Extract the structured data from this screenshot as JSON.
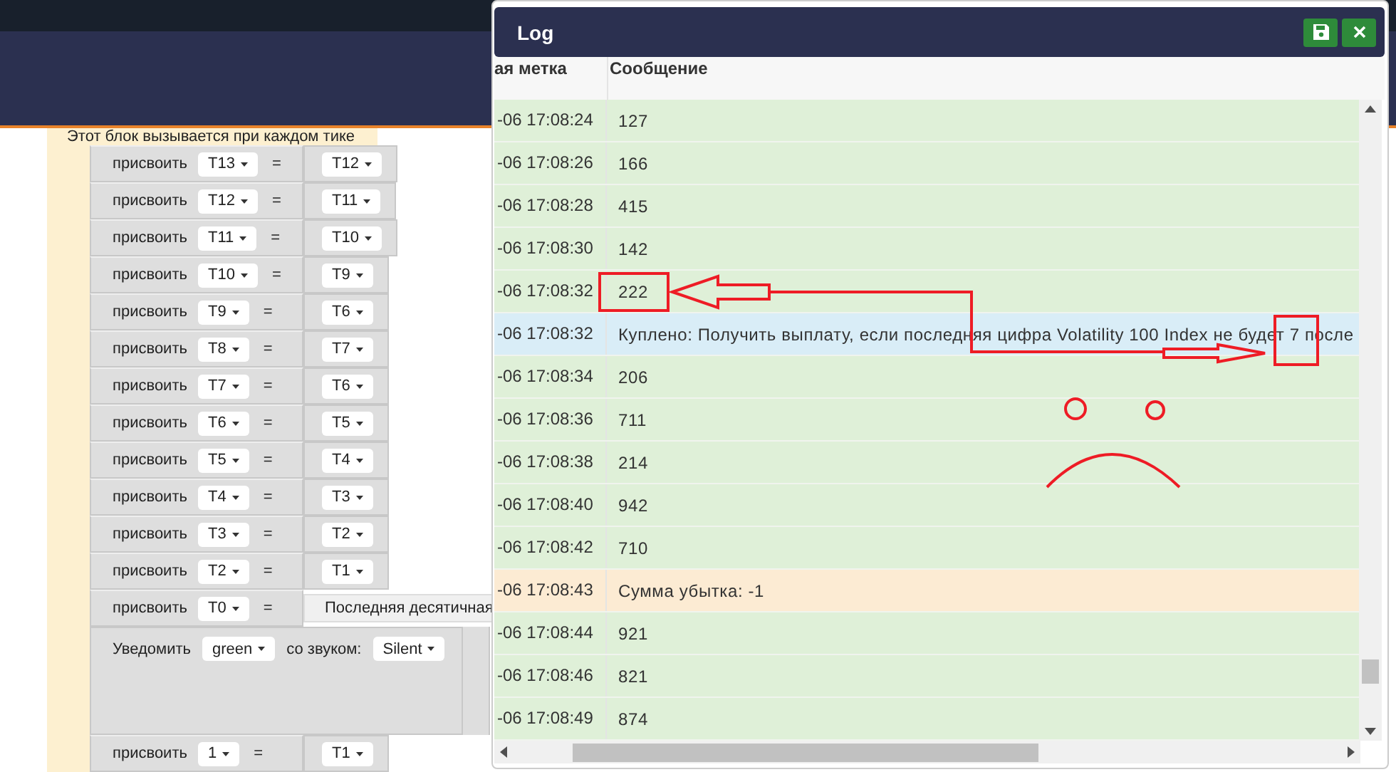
{
  "workspace": {
    "event_label": "Этот блок вызывается при каждом тике",
    "blocks": [
      {
        "kind": "assign",
        "label": "присвоить",
        "target": "T13",
        "op": "=",
        "value": {
          "kind": "dropdown",
          "text": "T12"
        }
      },
      {
        "kind": "assign",
        "label": "присвоить",
        "target": "T12",
        "op": "=",
        "value": {
          "kind": "dropdown",
          "text": "T11"
        }
      },
      {
        "kind": "assign",
        "label": "присвоить",
        "target": "T11",
        "op": "=",
        "value": {
          "kind": "dropdown",
          "text": "T10"
        }
      },
      {
        "kind": "assign",
        "label": "присвоить",
        "target": "T10",
        "op": "=",
        "value": {
          "kind": "dropdown",
          "text": "T9"
        }
      },
      {
        "kind": "assign",
        "label": "присвоить",
        "target": "T9",
        "op": "=",
        "value": {
          "kind": "dropdown",
          "text": "T6"
        }
      },
      {
        "kind": "assign",
        "label": "присвоить",
        "target": "T8",
        "op": "=",
        "value": {
          "kind": "dropdown",
          "text": "T7"
        }
      },
      {
        "kind": "assign",
        "label": "присвоить",
        "target": "T7",
        "op": "=",
        "value": {
          "kind": "dropdown",
          "text": "T6"
        }
      },
      {
        "kind": "assign",
        "label": "присвоить",
        "target": "T6",
        "op": "=",
        "value": {
          "kind": "dropdown",
          "text": "T5"
        }
      },
      {
        "kind": "assign",
        "label": "присвоить",
        "target": "T5",
        "op": "=",
        "value": {
          "kind": "dropdown",
          "text": "T4"
        }
      },
      {
        "kind": "assign",
        "label": "присвоить",
        "target": "T4",
        "op": "=",
        "value": {
          "kind": "dropdown",
          "text": "T3"
        }
      },
      {
        "kind": "assign",
        "label": "присвоить",
        "target": "T3",
        "op": "=",
        "value": {
          "kind": "dropdown",
          "text": "T2"
        }
      },
      {
        "kind": "assign",
        "label": "присвоить",
        "target": "T2",
        "op": "=",
        "value": {
          "kind": "dropdown",
          "text": "T1"
        }
      },
      {
        "kind": "assign",
        "label": "присвоить",
        "target": "T0",
        "op": "=",
        "value": {
          "kind": "block",
          "text": "Последняя десятичная"
        }
      },
      {
        "kind": "notify",
        "label": "Уведомить",
        "style": "green",
        "sound_label": "со звуком:",
        "sound": "Silent"
      },
      {
        "kind": "assign",
        "label": "присвоить",
        "target": "1",
        "op": "=",
        "value": {
          "kind": "dropdown",
          "text": "T1"
        }
      }
    ]
  },
  "log_window": {
    "title": "Log",
    "columns": [
      "ая метка",
      "Сообщение"
    ],
    "rows": [
      {
        "kind": "success",
        "time": "-06 17:08:24",
        "message": "127"
      },
      {
        "kind": "success",
        "time": "-06 17:08:26",
        "message": "166"
      },
      {
        "kind": "success",
        "time": "-06 17:08:28",
        "message": "415"
      },
      {
        "kind": "success",
        "time": "-06 17:08:30",
        "message": "142"
      },
      {
        "kind": "success",
        "time": "-06 17:08:32",
        "message": "222"
      },
      {
        "kind": "info",
        "time": "-06 17:08:32",
        "message": "Куплено: Получить выплату, если последняя цифра Volatility 100 Index не будет 7 после"
      },
      {
        "kind": "success",
        "time": "-06 17:08:34",
        "message": "206"
      },
      {
        "kind": "success",
        "time": "-06 17:08:36",
        "message": "711"
      },
      {
        "kind": "success",
        "time": "-06 17:08:38",
        "message": "214"
      },
      {
        "kind": "success",
        "time": "-06 17:08:40",
        "message": "942"
      },
      {
        "kind": "success",
        "time": "-06 17:08:42",
        "message": "710"
      },
      {
        "kind": "warning",
        "time": "-06 17:08:43",
        "message": "Сумма убытка: -1"
      },
      {
        "kind": "success",
        "time": "-06 17:08:44",
        "message": "921"
      },
      {
        "kind": "success",
        "time": "-06 17:08:46",
        "message": "821"
      },
      {
        "kind": "success",
        "time": "-06 17:08:49",
        "message": "874"
      }
    ]
  }
}
